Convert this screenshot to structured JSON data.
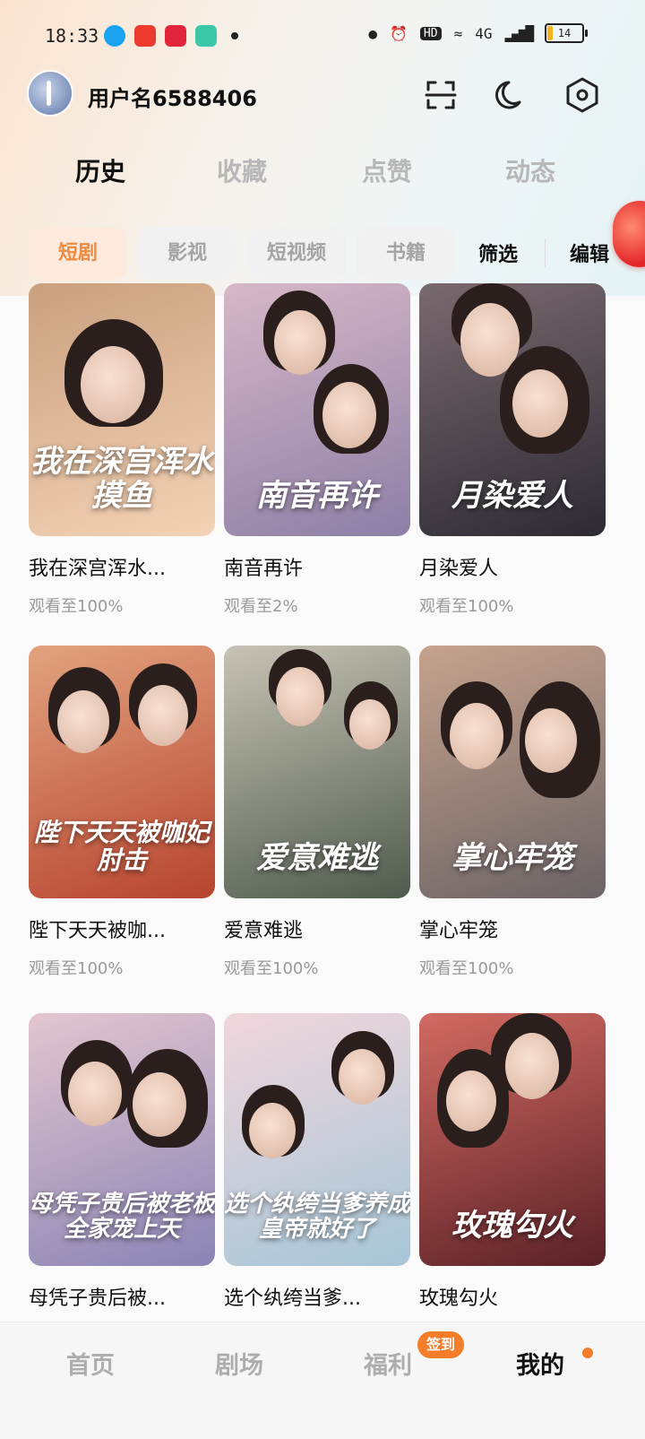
{
  "status_bar": {
    "time": "18:33",
    "network": "4G",
    "hd": "HD",
    "battery": "14",
    "battery_fraction": 0.14
  },
  "header": {
    "username": "用户名6588406",
    "icons": [
      "scan-icon",
      "dark-mode-icon",
      "settings-icon"
    ]
  },
  "tabs": [
    {
      "label": "历史",
      "active": true
    },
    {
      "label": "收藏",
      "active": false
    },
    {
      "label": "点赞",
      "active": false
    },
    {
      "label": "动态",
      "active": false
    }
  ],
  "chips": [
    {
      "label": "短剧",
      "active": true
    },
    {
      "label": "影视",
      "active": false
    },
    {
      "label": "短视频",
      "active": false
    },
    {
      "label": "书籍",
      "active": false
    }
  ],
  "filter_label": "筛选",
  "edit_label": "编辑",
  "items": [
    {
      "title": "我在深宫浑水...",
      "poster_text": "我在深宫浑水摸鱼",
      "progress": "观看至100%",
      "colors": [
        "#f3d2b6",
        "#c9a07e"
      ]
    },
    {
      "title": "南音再许",
      "poster_text": "南音再许",
      "progress": "观看至2%",
      "colors": [
        "#8c7fa6",
        "#d7b7c7"
      ]
    },
    {
      "title": "月染爱人",
      "poster_text": "月染爱人",
      "progress": "观看至100%",
      "colors": [
        "#2d2a34",
        "#7a6a6f"
      ]
    },
    {
      "title": "陛下天天被咖...",
      "poster_text": "陛下天天被咖妃肘击",
      "progress": "观看至100%",
      "colors": [
        "#b7442f",
        "#e2a37f"
      ]
    },
    {
      "title": "爱意难逃",
      "poster_text": "爱意难逃",
      "progress": "观看至100%",
      "colors": [
        "#4f5b4e",
        "#c7c3b4"
      ]
    },
    {
      "title": "掌心牢笼",
      "poster_text": "掌心牢笼",
      "progress": "观看至100%",
      "colors": [
        "#6b6366",
        "#c6a38d"
      ]
    },
    {
      "title": "母凭子贵后被...",
      "poster_text": "母凭子贵后被老板全家宠上天",
      "progress": "",
      "colors": [
        "#8a84b5",
        "#e3c6cf"
      ]
    },
    {
      "title": "选个纨绔当爹...",
      "poster_text": "选个纨绔当爹养成皇帝就好了",
      "progress": "",
      "colors": [
        "#a6c6d7",
        "#f1d6dc"
      ]
    },
    {
      "title": "玫瑰勾火",
      "poster_text": "玫瑰勾火",
      "progress": "",
      "colors": [
        "#5a2127",
        "#d26a62"
      ]
    }
  ],
  "bottom_nav": [
    {
      "label": "首页",
      "active": false
    },
    {
      "label": "剧场",
      "active": false
    },
    {
      "label": "福利",
      "active": false,
      "badge": "签到"
    },
    {
      "label": "我的",
      "active": true
    }
  ]
}
